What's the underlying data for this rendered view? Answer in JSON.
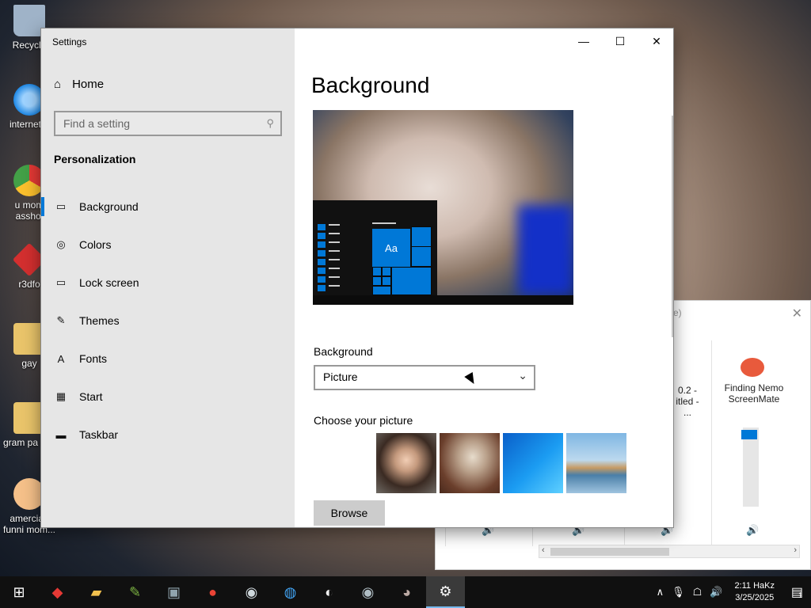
{
  "desktop": {
    "icons": [
      {
        "label": "Recycle",
        "icon": "recycle-bin-icon",
        "color": "#9fb3c8"
      },
      {
        "label": "internet p",
        "icon": "internet-explorer-icon",
        "color": "#1e88e5"
      },
      {
        "label": "u mom asshol",
        "icon": "chrome-icon",
        "color": "#e53935"
      },
      {
        "label": "r3dfo",
        "icon": "red-box-icon",
        "color": "#d32f2f"
      },
      {
        "label": "gay",
        "icon": "folder-icon",
        "color": "#e9c46a"
      },
      {
        "label": "gram pa ass",
        "icon": "folder-icon",
        "color": "#e9c46a"
      },
      {
        "label": "amercian funni mom...",
        "icon": "cartoon-face-icon",
        "color": "#f5c089"
      }
    ]
  },
  "mixer": {
    "header_fragment": "e)",
    "apps": [
      {
        "label": "0.2 - itled - ..."
      },
      {
        "label": "Finding Nemo ScreenMate"
      }
    ],
    "nemo_volume_fraction": 0.85
  },
  "settings": {
    "window_title": "Settings",
    "minimize": "—",
    "maximize": "☐",
    "close": "✕",
    "home_label": "Home",
    "search_placeholder": "Find a setting",
    "section": "Personalization",
    "nav": [
      {
        "label": "Background",
        "icon": "picture-icon",
        "glyph": "▭"
      },
      {
        "label": "Colors",
        "icon": "palette-icon",
        "glyph": "◎"
      },
      {
        "label": "Lock screen",
        "icon": "lock-screen-icon",
        "glyph": "▭"
      },
      {
        "label": "Themes",
        "icon": "themes-icon",
        "glyph": "✎"
      },
      {
        "label": "Fonts",
        "icon": "fonts-icon",
        "glyph": "A"
      },
      {
        "label": "Start",
        "icon": "start-icon",
        "glyph": "▦"
      },
      {
        "label": "Taskbar",
        "icon": "taskbar-icon",
        "glyph": "▬"
      }
    ],
    "page_title": "Background",
    "preview_tile_text": "Aa",
    "background_label": "Background",
    "background_value": "Picture",
    "choose_label": "Choose your picture",
    "browse_label": "Browse"
  },
  "taskbar": {
    "apps": [
      {
        "icon": "red-box-app-icon",
        "glyph": "◆",
        "color": "#e53935"
      },
      {
        "icon": "file-explorer-icon",
        "glyph": "▰",
        "color": "#f2c14e"
      },
      {
        "icon": "paint-palette-icon",
        "glyph": "✎",
        "color": "#7cb342"
      },
      {
        "icon": "computer-icon",
        "glyph": "▣",
        "color": "#90a4ae"
      },
      {
        "icon": "chrome-icon",
        "glyph": "●",
        "color": "#ea4335"
      },
      {
        "icon": "alien-icon",
        "glyph": "◉",
        "color": "#cfd8dc"
      },
      {
        "icon": "globe-icon",
        "glyph": "◍",
        "color": "#42a5f5"
      },
      {
        "icon": "obs-icon",
        "glyph": "◐",
        "color": "#eeeeee"
      },
      {
        "icon": "shield-icon",
        "glyph": "◉",
        "color": "#b0bec5"
      },
      {
        "icon": "gimp-icon",
        "glyph": "◕",
        "color": "#bcaaa4"
      },
      {
        "icon": "settings-gear-icon",
        "glyph": "⚙",
        "color": "#ffffff",
        "active": true
      }
    ],
    "tray": {
      "chevron": "∧",
      "mic": "🎙",
      "wifi": "☖",
      "volume": "🔊",
      "time": "2:11 HaKz",
      "date": "3/25/2025",
      "notifications": "1"
    }
  }
}
